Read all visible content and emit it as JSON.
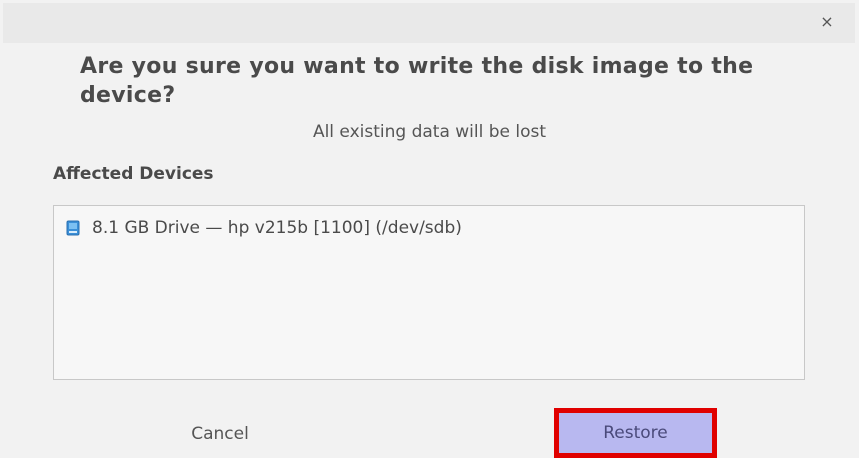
{
  "window": {
    "close_label": "×"
  },
  "dialog": {
    "title": "Are you sure you want to write the disk image to the device?",
    "subtitle": "All existing data will be lost",
    "section_label": "Affected Devices",
    "devices": [
      {
        "label": "8.1 GB Drive — hp v215b [1100] (/dev/sdb)",
        "icon": "drive-icon"
      }
    ]
  },
  "buttons": {
    "cancel_label": "Cancel",
    "restore_label": "Restore"
  },
  "colors": {
    "restore_bg": "#b8b8f0",
    "highlight": "#e00000"
  }
}
